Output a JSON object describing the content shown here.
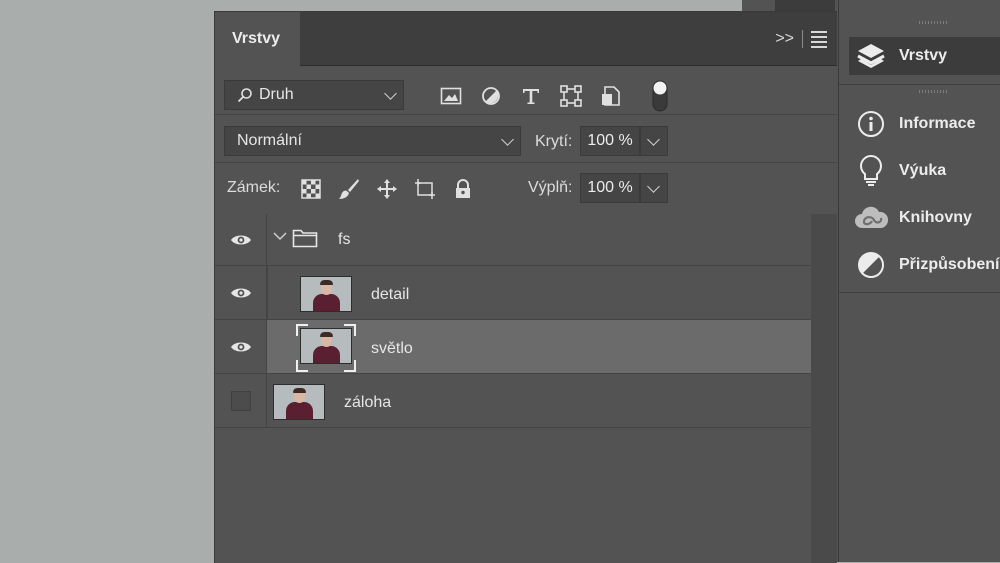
{
  "panel": {
    "tab_title": "Vrstvy",
    "collapse_glyph": ">>",
    "filter": {
      "selected": "Druh",
      "filter_icons": [
        "image-filter-icon",
        "adjustment-filter-icon",
        "type-filter-icon",
        "shape-filter-icon",
        "smart-object-filter-icon"
      ]
    },
    "blend_mode": "Normální",
    "opacity_label": "Krytí:",
    "opacity_value": "100 %",
    "lock_label": "Zámek:",
    "lock_icons": [
      "lock-transparent-pixels-icon",
      "lock-image-pixels-icon",
      "lock-position-icon",
      "lock-artboard-icon",
      "lock-all-icon"
    ],
    "fill_label": "Výplň:",
    "fill_value": "100 %",
    "layers": [
      {
        "name": "fs",
        "type": "group",
        "visible": true,
        "expanded": true
      },
      {
        "name": "detail",
        "type": "pixel",
        "visible": true,
        "selected": false
      },
      {
        "name": "světlo",
        "type": "pixel",
        "visible": true,
        "selected": true
      },
      {
        "name": "záloha",
        "type": "pixel",
        "visible": false,
        "selected": false
      }
    ]
  },
  "dock": {
    "items": [
      {
        "label": "Vrstvy",
        "icon": "layers-icon",
        "active": true
      },
      {
        "label": "Informace",
        "icon": "info-icon",
        "active": false
      },
      {
        "label": "Výuka",
        "icon": "lightbulb-icon",
        "active": false
      },
      {
        "label": "Knihovny",
        "icon": "cloud-libraries-icon",
        "active": false
      },
      {
        "label": "Přizpůsobení",
        "icon": "adjustments-icon",
        "active": false
      }
    ]
  },
  "colors": {
    "panel_bg": "#535353",
    "tabbar_bg": "#3e3e3e",
    "selected_row": "#6b6b6b",
    "canvas_bg": "#a9aeac"
  }
}
